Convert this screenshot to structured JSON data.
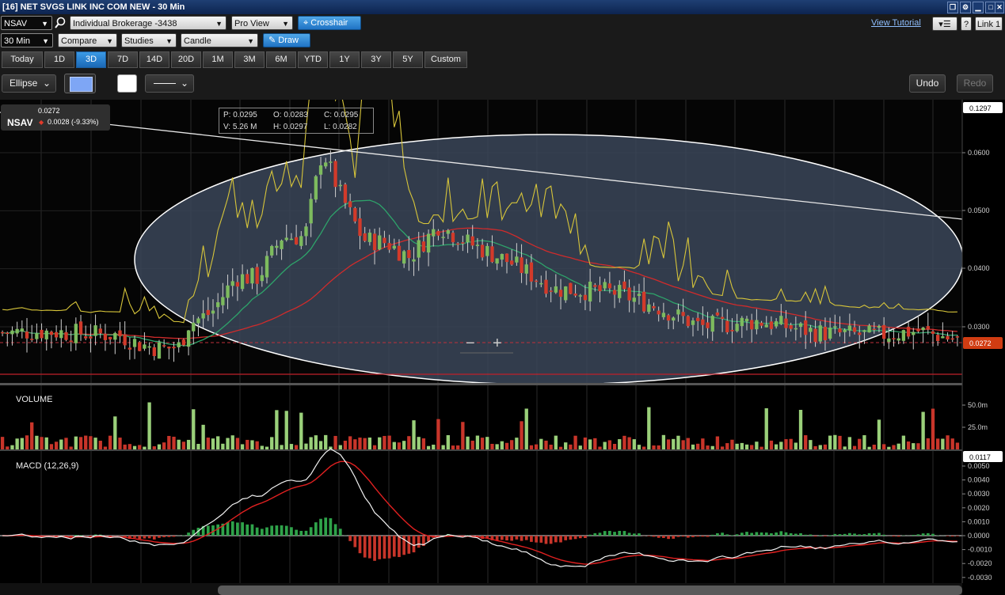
{
  "window": {
    "title": "[16] NET SVGS LINK INC COM NEW - 30 Min"
  },
  "toolbar": {
    "symbol": "NSAV",
    "account": "Individual Brokerage -3438",
    "view": "Pro View",
    "crosshair": "Crosshair",
    "view_tutorial": "View Tutorial",
    "help": "?",
    "link": "Link 1",
    "interval": "30 Min",
    "compare": "Compare",
    "studies": "Studies",
    "chart_type": "Candle",
    "draw": "Draw"
  },
  "ranges": [
    "Today",
    "1D",
    "3D",
    "7D",
    "14D",
    "20D",
    "1M",
    "3M",
    "6M",
    "YTD",
    "1Y",
    "3Y",
    "5Y",
    "Custom"
  ],
  "active_range": "3D",
  "draw_tools": {
    "shape": "Ellipse",
    "undo": "Undo",
    "redo": "Redo"
  },
  "quote": {
    "symbol": "NSAV",
    "last": "0.0272",
    "change": "0.0028 (-9.33%)"
  },
  "ohlc": {
    "p": "P: 0.0295",
    "o": "O: 0.0283",
    "c": "C: 0.0295",
    "v": "V: 5.26 M",
    "h": "H: 0.0297",
    "l": "L: 0.0282"
  },
  "zoom": {
    "minus": "−",
    "plus": "+"
  },
  "panels": {
    "volume_label": "VOLUME",
    "macd_label": "MACD (12,26,9)"
  },
  "colors": {
    "up": "#7dbb5e",
    "down": "#d23a2a",
    "accent": "#2f8ae0",
    "price_tag": "#d03c12"
  },
  "chart_data": [
    {
      "type": "candlestick",
      "title": "",
      "y_ticks": [
        "0.0600",
        "0.0500",
        "0.0400",
        "0.0300"
      ],
      "y_top_label": "0.1297",
      "last_price_label": "0.0272",
      "last_price": 0.0272,
      "ylim": [
        0.0187,
        0.0732
      ],
      "x_bars": 196,
      "overlays": [
        "moving averages (green, red)",
        "bollinger-style upper band (yellow)",
        "ellipse drawing",
        "trend line",
        "dashed last-price line"
      ]
    },
    {
      "type": "bar",
      "title": "VOLUME",
      "y_ticks": [
        "50.0m",
        "25.0m"
      ],
      "last_label": "0.0117",
      "ylim": [
        0,
        72
      ]
    },
    {
      "type": "line",
      "title": "MACD (12,26,9)",
      "y_ticks": [
        "0.0050",
        "0.0040",
        "0.0030",
        "0.0020",
        "0.0010",
        "0.0000",
        "-0.0010",
        "-0.0020",
        "-0.0030"
      ],
      "ylim": [
        -0.003,
        0.0057
      ],
      "series": [
        {
          "name": "MACD"
        },
        {
          "name": "Signal"
        },
        {
          "name": "Histogram"
        }
      ]
    }
  ]
}
